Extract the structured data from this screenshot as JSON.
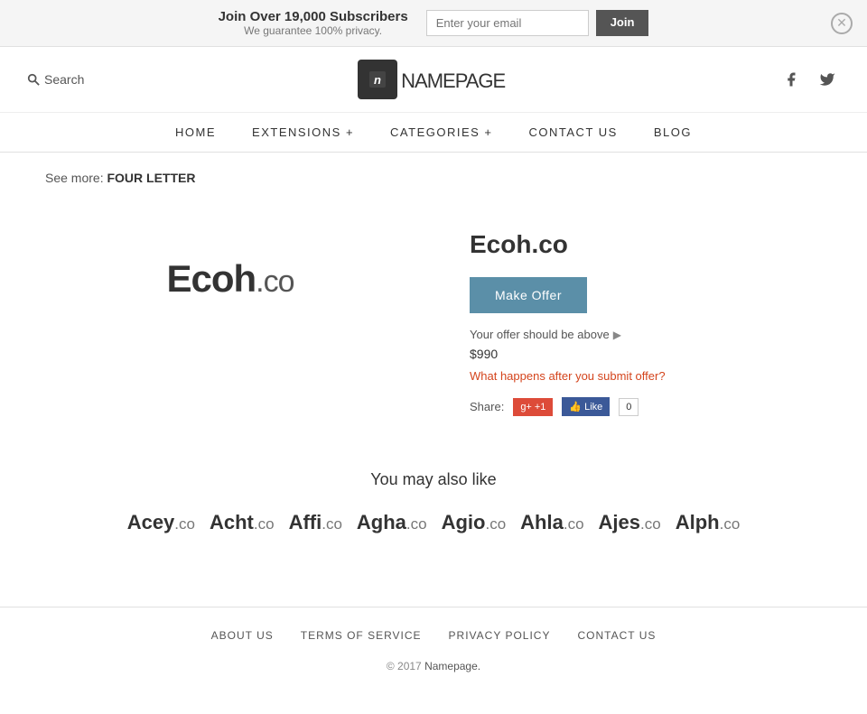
{
  "banner": {
    "title": "Join Over 19,000 Subscribers",
    "subtitle": "We guarantee 100% privacy.",
    "email_placeholder": "Enter your email",
    "join_label": "Join"
  },
  "header": {
    "search_label": "Search",
    "logo_icon": "n",
    "logo_name": "name",
    "logo_page": "PAGE",
    "facebook_url": "#",
    "twitter_url": "#"
  },
  "nav": {
    "items": [
      {
        "label": "HOME",
        "id": "home"
      },
      {
        "label": "EXTENSIONS +",
        "id": "extensions"
      },
      {
        "label": "CATEGORIES +",
        "id": "categories"
      },
      {
        "label": "CONTACT  US",
        "id": "contact"
      },
      {
        "label": "BLOG",
        "id": "blog"
      }
    ]
  },
  "breadcrumb": {
    "prefix": "See more:",
    "label": "FOUR LETTER"
  },
  "domain": {
    "display_name": "Ecoh",
    "tld": ".co",
    "full_name": "Ecoh.co",
    "make_offer_label": "Make Offer",
    "offer_hint": "Your offer should be above",
    "offer_price": "$990",
    "offer_link": "What happens after you submit offer?",
    "share_label": "Share:",
    "gplus_label": "+1",
    "fb_like_label": "Like",
    "fb_count": "0"
  },
  "also_like": {
    "title": "You may also like",
    "domains": [
      {
        "name": "Acey",
        "tld": ".co"
      },
      {
        "name": "Acht",
        "tld": ".co"
      },
      {
        "name": "Affi",
        "tld": ".co"
      },
      {
        "name": "Agha",
        "tld": ".co"
      },
      {
        "name": "Agio",
        "tld": ".co"
      },
      {
        "name": "Ahla",
        "tld": ".co"
      },
      {
        "name": "Ajes",
        "tld": ".co"
      },
      {
        "name": "Alph",
        "tld": ".co"
      }
    ]
  },
  "footer": {
    "links": [
      {
        "label": "ABOUT  US",
        "id": "about"
      },
      {
        "label": "TERMS  OF  SERVICE",
        "id": "terms"
      },
      {
        "label": "PRIVACY  POLICY",
        "id": "privacy"
      },
      {
        "label": "CONTACT  US",
        "id": "contact"
      }
    ],
    "copy": "© 2017",
    "brand": "Namepage."
  }
}
